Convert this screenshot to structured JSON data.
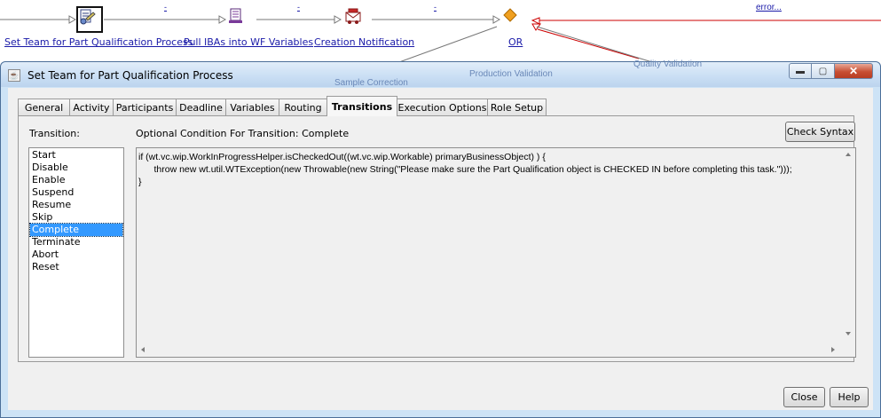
{
  "workflow": {
    "nodes": [
      {
        "label": "Set Team for Part Qualification Process",
        "icon": "team-activity-icon"
      },
      {
        "label": "Pull IBAs into WF Variables",
        "icon": "script-icon"
      },
      {
        "label": "Creation Notification",
        "icon": "notification-icon"
      },
      {
        "label": "OR",
        "icon": "or-connector-icon"
      }
    ],
    "error_link": "error...",
    "edge_marks": [
      "-",
      "-",
      "-"
    ],
    "background_labels": [
      "Production Validation",
      "Quality Validation",
      "Sample Correction"
    ]
  },
  "dialog": {
    "title": "Set Team for Part Qualification Process",
    "tabs": [
      "General",
      "Activity",
      "Participants",
      "Deadline",
      "Variables",
      "Routing",
      "Transitions",
      "Execution Options",
      "Role Setup"
    ],
    "active_tab": "Transitions",
    "transition_label": "Transition:",
    "condition_label": "Optional Condition For Transition: Complete",
    "check_syntax_button": "Check Syntax",
    "transitions": [
      "Start",
      "Disable",
      "Enable",
      "Suspend",
      "Resume",
      "Skip",
      "Complete",
      "Terminate",
      "Abort",
      "Reset"
    ],
    "selected_transition": "Complete",
    "code_lines": [
      "if (wt.vc.wip.WorkInProgressHelper.isCheckedOut((wt.vc.wip.Workable) primaryBusinessObject) ) {",
      "      throw new wt.util.WTException(new Throwable(new String(\"Please make sure the Part Qualification object is CHECKED IN before completing this task.\")));",
      "}"
    ],
    "close_button": "Close",
    "help_button": "Help"
  },
  "colors": {
    "link": "#1a1aa8",
    "selection": "#3399ff",
    "dialog_frame": "#cde3f6",
    "error_line": "#cc0000",
    "or_diamond": "#f0a020"
  }
}
